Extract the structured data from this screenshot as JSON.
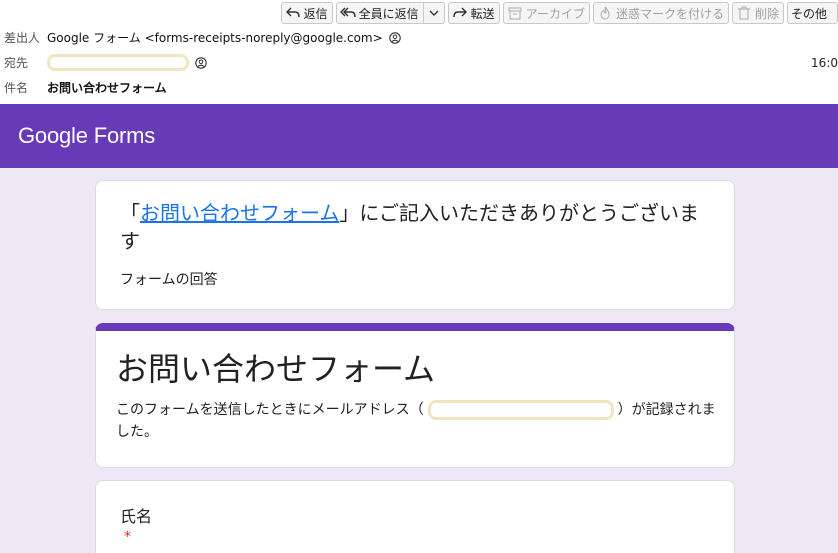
{
  "toolbar": {
    "reply": "返信",
    "reply_all": "全員に返信",
    "forward": "転送",
    "archive": "アーカイブ",
    "junk": "迷惑マークを付ける",
    "delete": "削除",
    "more": "その他"
  },
  "header": {
    "from_label": "差出人",
    "from_value": "Google フォーム <forms-receipts-noreply@google.com>",
    "to_label": "宛先",
    "time": "16:0",
    "subject_label": "件名",
    "subject_value": "お問い合わせフォーム"
  },
  "banner": {
    "google": "Google",
    "forms": "Forms",
    "color": "#673ab7"
  },
  "thanks_card": {
    "open_quote": "「",
    "form_link": "お問い合わせフォーム",
    "message": "」にご記入いただきありがとうございます",
    "responses_label": "フォームの回答"
  },
  "form_card": {
    "title": "お問い合わせフォーム",
    "note_before": "このフォームを送信したときにメールアドレス（",
    "note_after": "）が記録されました。"
  },
  "question_card": {
    "label": "氏名",
    "required_mark": "*"
  }
}
